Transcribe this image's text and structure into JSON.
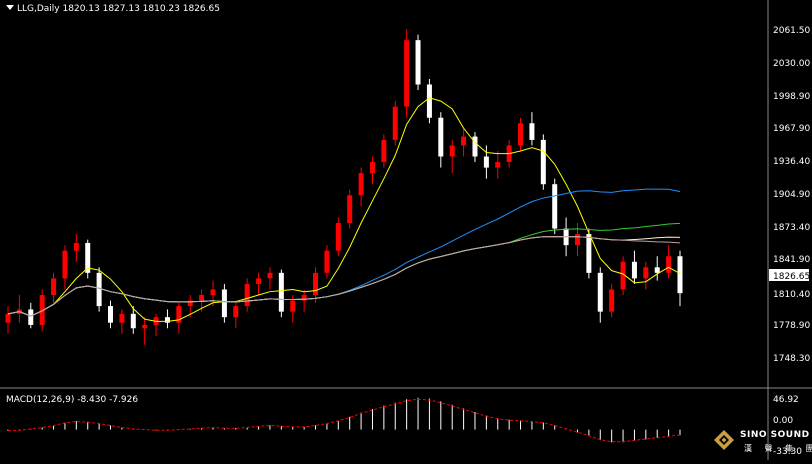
{
  "header": {
    "symbol": "LLG,Daily",
    "ohlc": "1820.13 1827.13 1810.23 1826.65"
  },
  "price_axis": {
    "ticks": [
      "2061.50",
      "2030.00",
      "1998.90",
      "1967.90",
      "1936.40",
      "1904.90",
      "1873.40",
      "1841.90",
      "1810.40",
      "1778.90",
      "1748.30"
    ],
    "current_price": "1826.65"
  },
  "macd": {
    "label": "MACD(12,26,9) -8.430 -7.926",
    "ticks": [
      "46.92",
      "0.00",
      "-33.30"
    ]
  },
  "logo": {
    "name": "SINO SOUND",
    "subtitle": "漢 聲 集 團"
  },
  "colors": {
    "up": "#ff0000",
    "down": "#ffffff",
    "ma_short": "#ffff00",
    "ma_mid": "#1e90ff",
    "ma_long1": "#32cd32",
    "ma_long2": "#f5f5dc",
    "ma_long3": "#c0a0a0",
    "signal": "#ff0000",
    "histogram": "#ffffff"
  },
  "chart_data": {
    "type": "candlestick",
    "price_ylim": [
      1748.3,
      2075
    ],
    "macd_ylim": [
      -33.3,
      46.92
    ],
    "candles": [
      [
        1800,
        1815,
        1790,
        1808
      ],
      [
        1808,
        1825,
        1800,
        1812
      ],
      [
        1812,
        1818,
        1795,
        1798
      ],
      [
        1798,
        1830,
        1792,
        1825
      ],
      [
        1825,
        1845,
        1818,
        1840
      ],
      [
        1840,
        1870,
        1830,
        1865
      ],
      [
        1865,
        1880,
        1855,
        1872
      ],
      [
        1872,
        1875,
        1840,
        1845
      ],
      [
        1845,
        1850,
        1810,
        1815
      ],
      [
        1815,
        1820,
        1795,
        1800
      ],
      [
        1800,
        1812,
        1790,
        1808
      ],
      [
        1808,
        1815,
        1790,
        1795
      ],
      [
        1795,
        1805,
        1780,
        1798
      ],
      [
        1798,
        1808,
        1788,
        1805
      ],
      [
        1805,
        1812,
        1795,
        1800
      ],
      [
        1800,
        1818,
        1790,
        1815
      ],
      [
        1815,
        1825,
        1805,
        1820
      ],
      [
        1820,
        1830,
        1810,
        1825
      ],
      [
        1825,
        1838,
        1815,
        1830
      ],
      [
        1830,
        1835,
        1800,
        1805
      ],
      [
        1805,
        1820,
        1795,
        1815
      ],
      [
        1815,
        1840,
        1810,
        1835
      ],
      [
        1835,
        1845,
        1825,
        1840
      ],
      [
        1840,
        1850,
        1830,
        1845
      ],
      [
        1845,
        1848,
        1805,
        1810
      ],
      [
        1810,
        1825,
        1800,
        1820
      ],
      [
        1820,
        1830,
        1810,
        1825
      ],
      [
        1825,
        1850,
        1818,
        1845
      ],
      [
        1845,
        1870,
        1840,
        1865
      ],
      [
        1865,
        1895,
        1860,
        1890
      ],
      [
        1890,
        1920,
        1885,
        1915
      ],
      [
        1915,
        1940,
        1905,
        1935
      ],
      [
        1935,
        1950,
        1925,
        1945
      ],
      [
        1945,
        1970,
        1940,
        1965
      ],
      [
        1965,
        2000,
        1960,
        1995
      ],
      [
        1995,
        2065,
        1985,
        2055
      ],
      [
        2055,
        2060,
        2010,
        2015
      ],
      [
        2015,
        2020,
        1980,
        1985
      ],
      [
        1985,
        1990,
        1940,
        1950
      ],
      [
        1950,
        1965,
        1935,
        1960
      ],
      [
        1960,
        1975,
        1950,
        1968
      ],
      [
        1968,
        1972,
        1945,
        1950
      ],
      [
        1950,
        1960,
        1930,
        1940
      ],
      [
        1940,
        1955,
        1930,
        1945
      ],
      [
        1945,
        1965,
        1940,
        1960
      ],
      [
        1960,
        1985,
        1955,
        1980
      ],
      [
        1980,
        1990,
        1960,
        1965
      ],
      [
        1965,
        1970,
        1920,
        1925
      ],
      [
        1925,
        1930,
        1880,
        1885
      ],
      [
        1885,
        1895,
        1860,
        1870
      ],
      [
        1870,
        1890,
        1860,
        1880
      ],
      [
        1880,
        1885,
        1840,
        1845
      ],
      [
        1845,
        1850,
        1800,
        1810
      ],
      [
        1810,
        1835,
        1805,
        1830
      ],
      [
        1830,
        1860,
        1825,
        1855
      ],
      [
        1855,
        1865,
        1835,
        1840
      ],
      [
        1840,
        1855,
        1830,
        1850
      ],
      [
        1850,
        1860,
        1838,
        1845
      ],
      [
        1845,
        1870,
        1840,
        1860
      ],
      [
        1860,
        1865,
        1815,
        1826.65
      ]
    ],
    "macd_signal": [
      -2,
      -1,
      1,
      3,
      6,
      10,
      12,
      11,
      9,
      6,
      3,
      1,
      0,
      -1,
      -1,
      0,
      1,
      2,
      3,
      2,
      2,
      3,
      5,
      6,
      5,
      4,
      4,
      6,
      9,
      13,
      18,
      24,
      29,
      34,
      38,
      43,
      45,
      44,
      40,
      35,
      30,
      25,
      20,
      16,
      14,
      13,
      12,
      10,
      6,
      1,
      -4,
      -9,
      -15,
      -18,
      -18,
      -16,
      -14,
      -12,
      -10,
      -8
    ]
  }
}
